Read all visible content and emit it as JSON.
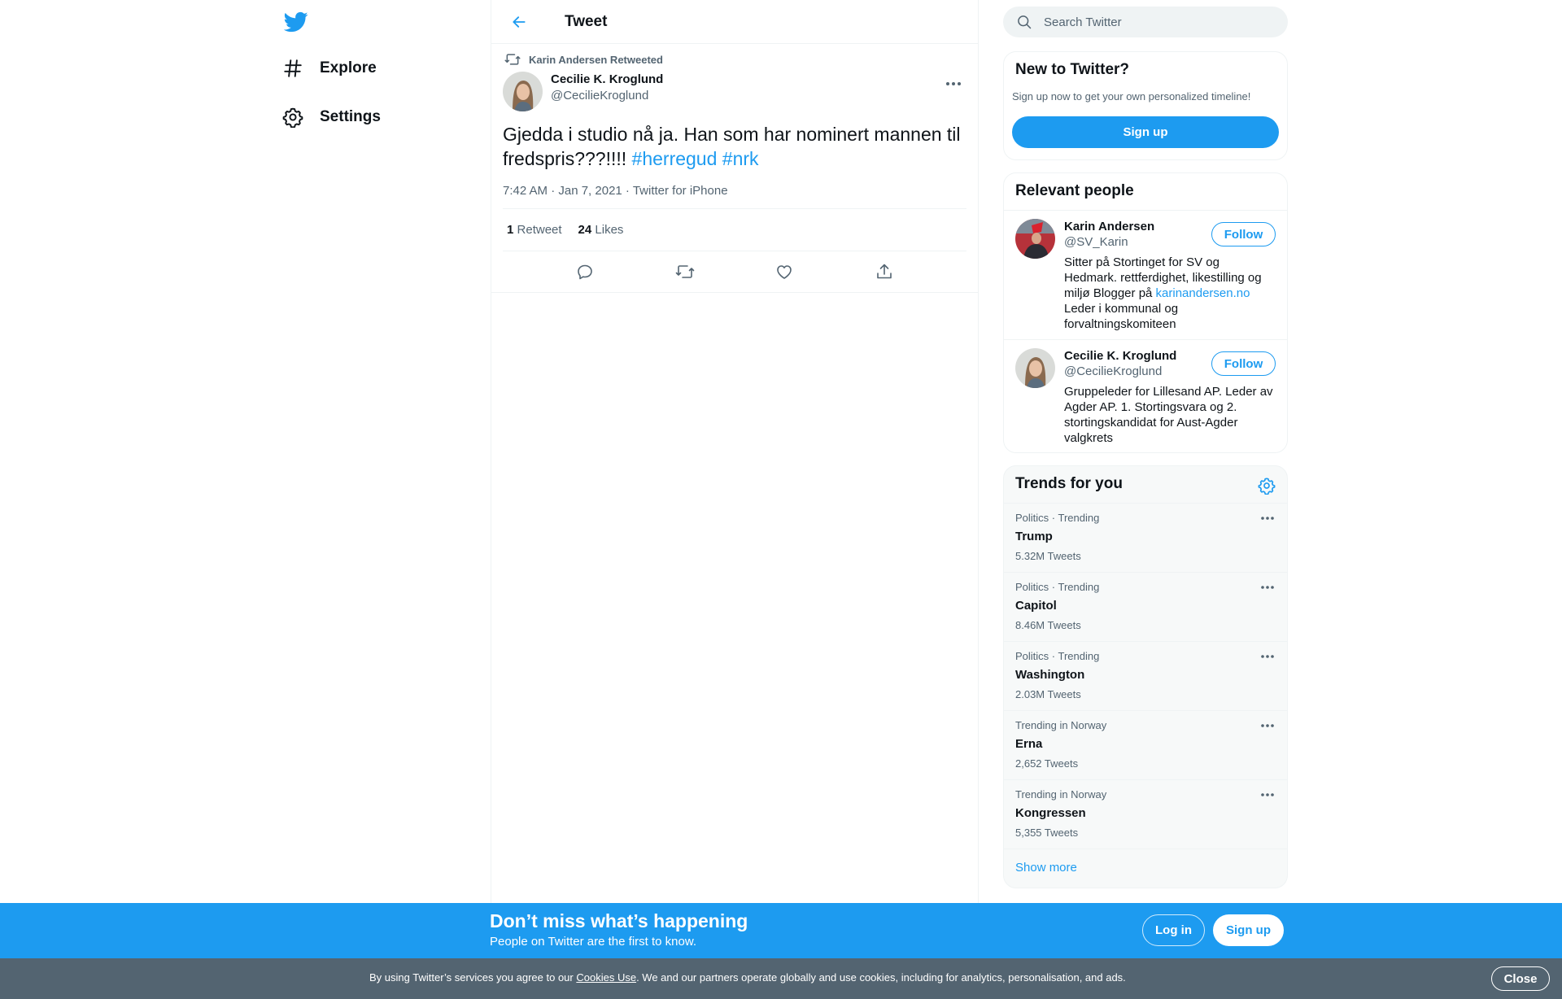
{
  "colors": {
    "accent": "#1d9bf0",
    "text": "#0f1419",
    "secondary": "#536471",
    "cookie_bg": "#536471"
  },
  "nav": {
    "logo_icon": "twitter-bird-icon",
    "items": [
      {
        "icon": "hashtag-icon",
        "label": "Explore"
      },
      {
        "icon": "gear-icon",
        "label": "Settings"
      }
    ]
  },
  "header": {
    "back_icon": "arrow-left-icon",
    "title": "Tweet"
  },
  "tweet": {
    "retweeted_by": "Karin Andersen Retweeted",
    "author_name": "Cecilie K. Kroglund",
    "author_handle": "@CecilieKroglund",
    "text": "Gjedda i studio nå ja. Han som har nominert mannen til fredspris???!!!! ",
    "hashtags": [
      "#herregud",
      "#nrk"
    ],
    "timestamp": "7:42 AM · Jan 7, 2021",
    "meta_sep": " · ",
    "source": "Twitter for iPhone",
    "retweets_count": "1",
    "retweets_label": "Retweet",
    "likes_count": "24",
    "likes_label": "Likes",
    "actions": [
      "reply-icon",
      "retweet-icon",
      "like-icon",
      "share-icon"
    ]
  },
  "search": {
    "placeholder": "Search Twitter"
  },
  "new_to_twitter": {
    "title": "New to Twitter?",
    "subtitle": "Sign up now to get your own personalized timeline!",
    "signup_label": "Sign up"
  },
  "relevant_people": {
    "title": "Relevant people",
    "people": [
      {
        "name": "Karin Andersen",
        "handle": "@SV_Karin",
        "bio_before": "Sitter på Stortinget for SV og Hedmark. rettferdighet, likestilling og miljø Blogger på ",
        "bio_link": "karinandersen.no",
        "bio_after": " Leder i kommunal og forvaltningskomiteen",
        "follow_label": "Follow"
      },
      {
        "name": "Cecilie K. Kroglund",
        "handle": "@CecilieKroglund",
        "bio_before": "Gruppeleder for Lillesand AP. Leder av Agder AP. 1. Stortingsvara og 2. stortingskandidat for Aust-Agder valgkrets",
        "bio_link": "",
        "bio_after": "",
        "follow_label": "Follow"
      }
    ]
  },
  "trends": {
    "title": "Trends for you",
    "items": [
      {
        "context": "Politics · Trending",
        "name": "Trump",
        "count": "5.32M Tweets"
      },
      {
        "context": "Politics · Trending",
        "name": "Capitol",
        "count": "8.46M Tweets"
      },
      {
        "context": "Politics · Trending",
        "name": "Washington",
        "count": "2.03M Tweets"
      },
      {
        "context": "Trending in Norway",
        "name": "Erna",
        "count": "2,652 Tweets"
      },
      {
        "context": "Trending in Norway",
        "name": "Kongressen",
        "count": "5,355 Tweets"
      }
    ],
    "show_more": "Show more"
  },
  "banner": {
    "title": "Don’t miss what’s happening",
    "subtitle": "People on Twitter are the first to know.",
    "login_label": "Log in",
    "signup_label": "Sign up"
  },
  "cookie": {
    "text_before": "By using Twitter’s services you agree to our ",
    "link": "Cookies Use",
    "text_after": ". We and our partners operate globally and use cookies, including for analytics, personalisation, and ads.",
    "close_label": "Close"
  }
}
